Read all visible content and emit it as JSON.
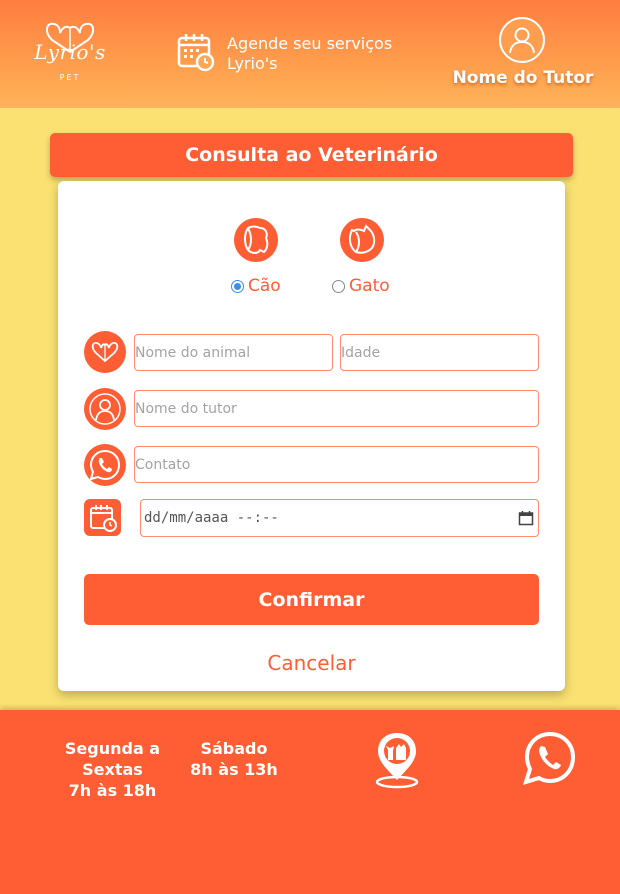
{
  "header": {
    "brand": "Lyrio's",
    "brand_sub": "PET",
    "booking_line1": "Agende seu serviços",
    "booking_line2": "Lyrio's",
    "user_name": "Nome do Tutor"
  },
  "title": "Consulta ao Veterinário",
  "species": [
    {
      "label": "Cão",
      "selected": true
    },
    {
      "label": "Gato",
      "selected": false
    }
  ],
  "form": {
    "animal_name_placeholder": "Nome do animal",
    "age_placeholder": "Idade",
    "tutor_placeholder": "Nome do tutor",
    "contact_placeholder": "Contato",
    "datetime_placeholder": "dd/mm/aaaa --:--",
    "confirm_label": "Confirmar",
    "cancel_label": "Cancelar"
  },
  "footer": {
    "weekdays_title": "Segunda a Sextas",
    "weekdays_hours": "7h às 18h",
    "saturday_title": "Sábado",
    "saturday_hours": "8h às 13h"
  },
  "icons": {
    "logo": "pet-heart-icon",
    "booking": "calendar-clock-icon",
    "avatar": "user-icon",
    "map": "map-pin-pets-icon",
    "whatsapp": "whatsapp-icon"
  },
  "colors": {
    "accent": "#ff5d34",
    "background": "#fae172",
    "header_gradient_top": "#ff7d3f",
    "header_gradient_bottom": "#ffb35c",
    "radio_selected": "#3b8fe6"
  }
}
